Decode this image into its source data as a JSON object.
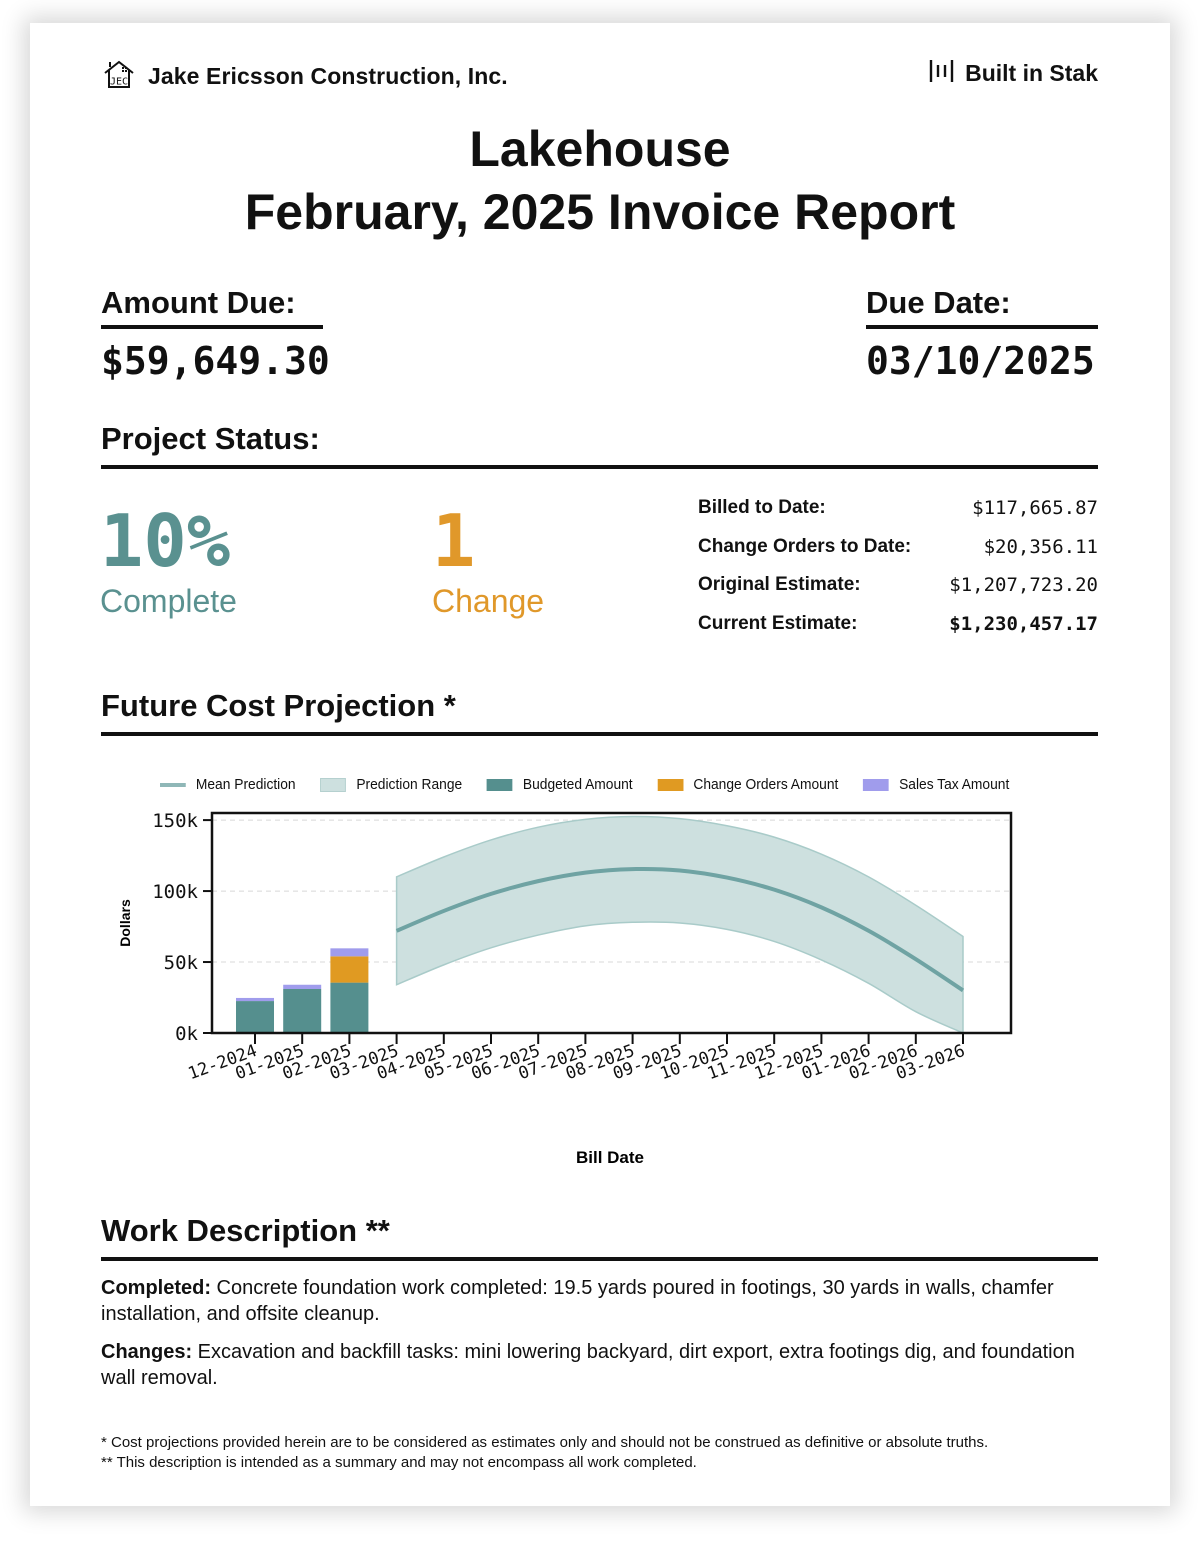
{
  "header": {
    "company_name": "Jake Ericsson Construction, Inc.",
    "company_logo_text": "JEC",
    "brand_label": "Built in Stak"
  },
  "title": {
    "project": "Lakehouse",
    "report": "February, 2025 Invoice Report"
  },
  "amount_due": {
    "label": "Amount Due:",
    "value": "$59,649.30"
  },
  "due_date": {
    "label": "Due Date:",
    "value": "03/10/2025"
  },
  "project_status": {
    "heading": "Project Status:",
    "percent_complete": "10%",
    "percent_label": "Complete",
    "change_count": "1",
    "change_label": "Change",
    "stats": [
      {
        "label": "Billed to Date:",
        "value": "$117,665.87"
      },
      {
        "label": "Change Orders to Date:",
        "value": "$20,356.11"
      },
      {
        "label": "Original Estimate:",
        "value": "$1,207,723.20"
      },
      {
        "label": "Current Estimate:",
        "value": "$1,230,457.17"
      }
    ]
  },
  "projection": {
    "heading": "Future Cost Projection *"
  },
  "colors": {
    "teal": "#5a9190",
    "orange": "#e0982a",
    "budget": "#558f8e",
    "change_orders": "#e09a22",
    "sales_tax": "#a09cec",
    "mean_line": "#6fa3a3",
    "range_fill": "#cde0df"
  },
  "chart_data": {
    "type": "bar+line+area",
    "title": "",
    "xlabel": "Bill Date",
    "ylabel": "Dollars",
    "ylim": [
      0,
      155000
    ],
    "yticks": [
      0,
      50000,
      100000,
      150000
    ],
    "ytick_labels": [
      "0k",
      "50k",
      "100k",
      "150k"
    ],
    "grid": "horizontal-dashed",
    "legend_position": "top",
    "legend": [
      "Mean Prediction",
      "Prediction Range",
      "Budgeted Amount",
      "Change Orders Amount",
      "Sales Tax Amount"
    ],
    "categories": [
      "12-2024",
      "01-2025",
      "02-2025",
      "03-2025",
      "04-2025",
      "05-2025",
      "06-2025",
      "07-2025",
      "08-2025",
      "09-2025",
      "10-2025",
      "11-2025",
      "12-2025",
      "01-2026",
      "02-2026",
      "03-2026"
    ],
    "bars": {
      "categories": [
        "12-2024",
        "01-2025",
        "02-2025"
      ],
      "series": [
        {
          "name": "Budgeted Amount",
          "values": [
            22500,
            31000,
            35500
          ]
        },
        {
          "name": "Change Orders Amount",
          "values": [
            0,
            0,
            18500
          ]
        },
        {
          "name": "Sales Tax Amount",
          "values": [
            2200,
            3000,
            5650
          ]
        }
      ]
    },
    "projection": {
      "x": [
        "03-2025",
        "04-2025",
        "05-2025",
        "06-2025",
        "07-2025",
        "08-2025",
        "09-2025",
        "10-2025",
        "11-2025",
        "12-2025",
        "01-2026",
        "02-2026",
        "03-2026"
      ],
      "mean": [
        72000,
        86000,
        98000,
        107000,
        113000,
        115500,
        114500,
        109500,
        101000,
        88500,
        72000,
        52000,
        30000
      ],
      "upper": [
        110000,
        124000,
        136000,
        145000,
        150500,
        152500,
        151000,
        146000,
        138000,
        126000,
        110000,
        90000,
        68000
      ],
      "lower": [
        34000,
        48000,
        60000,
        69000,
        75500,
        78000,
        77500,
        73000,
        64500,
        51500,
        35000,
        15000,
        0
      ]
    }
  },
  "work_description": {
    "heading": "Work Description **",
    "completed_label": "Completed:",
    "completed_text": " Concrete foundation work completed: 19.5 yards poured in footings, 30 yards in walls, chamfer installation, and offsite cleanup.",
    "changes_label": "Changes:",
    "changes_text": " Excavation and backfill tasks: mini lowering backyard, dirt export, extra footings dig, and foundation wall removal."
  },
  "footnotes": [
    "* Cost projections provided herein are to be considered as estimates only and should not be construed as definitive or absolute truths.",
    "** This description is intended as a summary and may not encompass all work completed."
  ]
}
